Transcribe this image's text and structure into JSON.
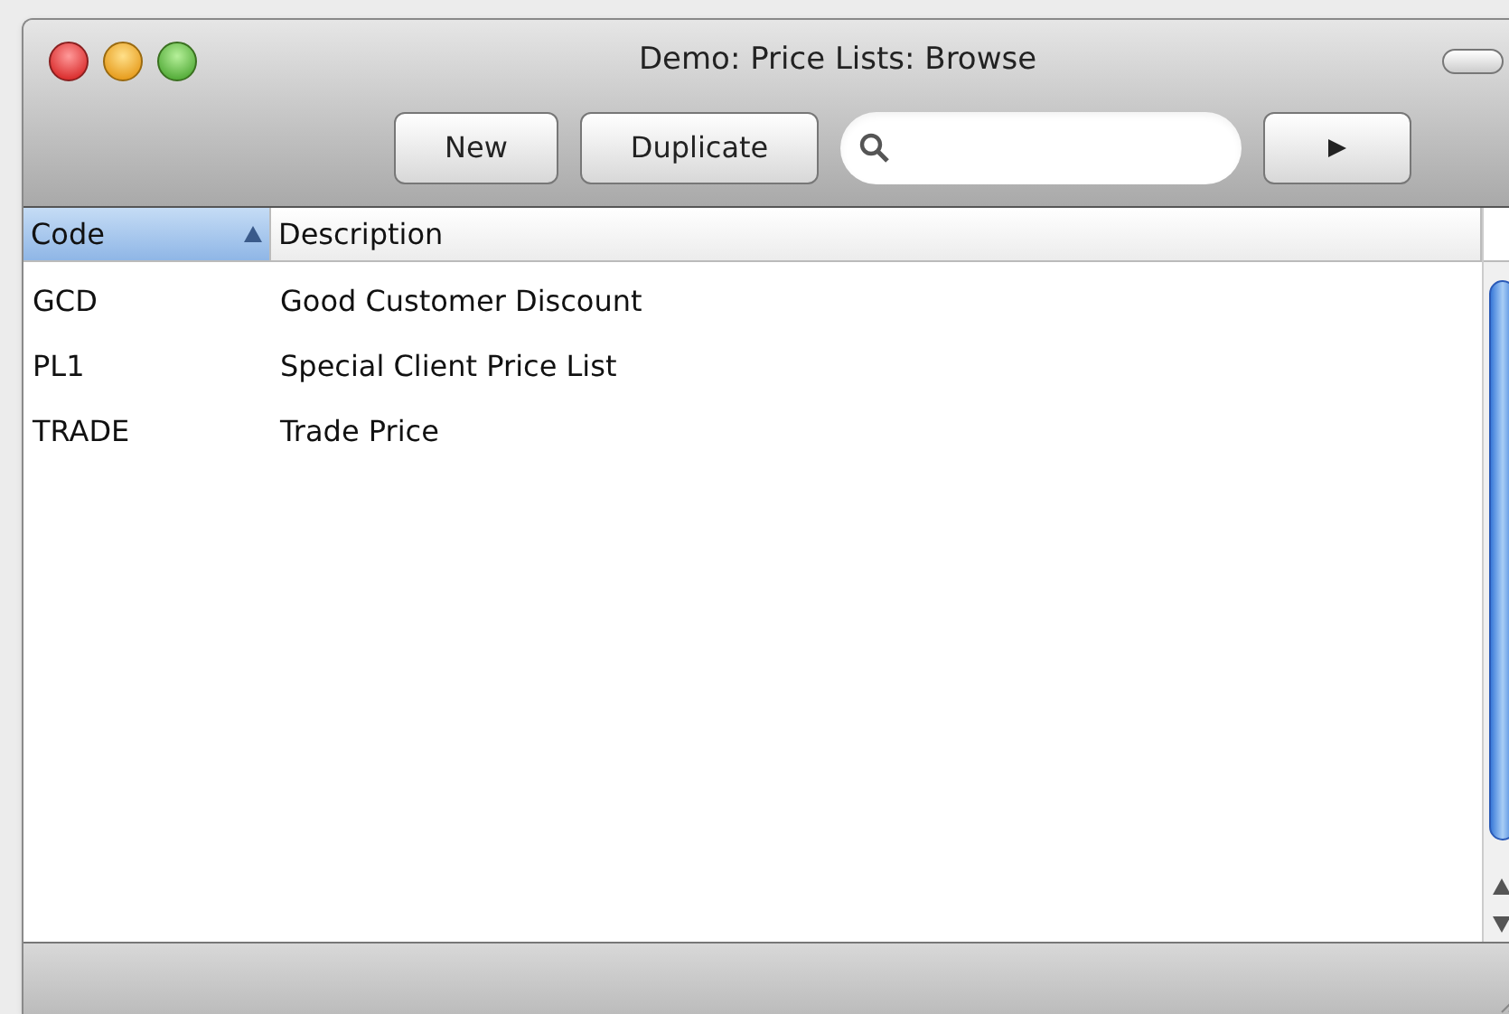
{
  "window": {
    "title": "Demo: Price Lists: Browse"
  },
  "toolbar": {
    "buttons": [
      "New",
      "Duplicate"
    ]
  },
  "table": {
    "columns": [
      {
        "label": "Code",
        "selected": true
      },
      {
        "label": "Description",
        "selected": false
      }
    ],
    "rows": [
      [
        "GCD",
        "Good Customer Discount"
      ],
      [
        "PL1",
        "Special Client Price List"
      ],
      [
        "TRADE",
        "Trade Price"
      ]
    ]
  }
}
